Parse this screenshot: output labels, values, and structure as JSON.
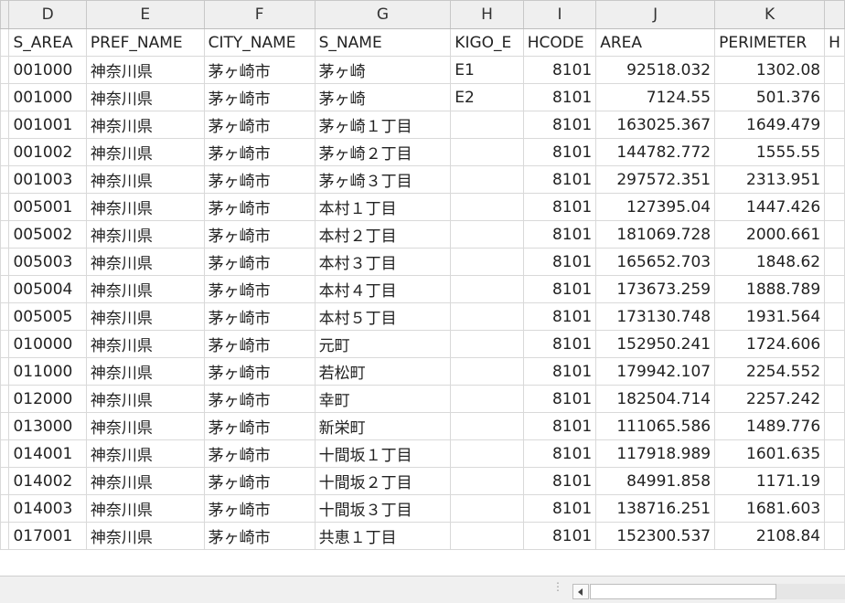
{
  "columns": [
    {
      "letter": "D",
      "header": "S_AREA",
      "align": "left"
    },
    {
      "letter": "E",
      "header": "PREF_NAME",
      "align": "left"
    },
    {
      "letter": "F",
      "header": "CITY_NAME",
      "align": "left"
    },
    {
      "letter": "G",
      "header": "S_NAME",
      "align": "left"
    },
    {
      "letter": "H",
      "header": "KIGO_E",
      "align": "left"
    },
    {
      "letter": "I",
      "header": "HCODE",
      "align": "right"
    },
    {
      "letter": "J",
      "header": "AREA",
      "align": "right"
    },
    {
      "letter": "K",
      "header": "PERIMETER",
      "align": "right"
    },
    {
      "letter": "",
      "header": "H",
      "align": "left"
    }
  ],
  "rows": [
    [
      "001000",
      "神奈川県",
      "茅ヶ崎市",
      "茅ヶ崎",
      "E1",
      "8101",
      "92518.032",
      "1302.08",
      ""
    ],
    [
      "001000",
      "神奈川県",
      "茅ヶ崎市",
      "茅ヶ崎",
      "E2",
      "8101",
      "7124.55",
      "501.376",
      ""
    ],
    [
      "001001",
      "神奈川県",
      "茅ヶ崎市",
      "茅ヶ崎１丁目",
      "",
      "8101",
      "163025.367",
      "1649.479",
      ""
    ],
    [
      "001002",
      "神奈川県",
      "茅ヶ崎市",
      "茅ヶ崎２丁目",
      "",
      "8101",
      "144782.772",
      "1555.55",
      ""
    ],
    [
      "001003",
      "神奈川県",
      "茅ヶ崎市",
      "茅ヶ崎３丁目",
      "",
      "8101",
      "297572.351",
      "2313.951",
      ""
    ],
    [
      "005001",
      "神奈川県",
      "茅ヶ崎市",
      "本村１丁目",
      "",
      "8101",
      "127395.04",
      "1447.426",
      ""
    ],
    [
      "005002",
      "神奈川県",
      "茅ヶ崎市",
      "本村２丁目",
      "",
      "8101",
      "181069.728",
      "2000.661",
      ""
    ],
    [
      "005003",
      "神奈川県",
      "茅ヶ崎市",
      "本村３丁目",
      "",
      "8101",
      "165652.703",
      "1848.62",
      ""
    ],
    [
      "005004",
      "神奈川県",
      "茅ヶ崎市",
      "本村４丁目",
      "",
      "8101",
      "173673.259",
      "1888.789",
      ""
    ],
    [
      "005005",
      "神奈川県",
      "茅ヶ崎市",
      "本村５丁目",
      "",
      "8101",
      "173130.748",
      "1931.564",
      ""
    ],
    [
      "010000",
      "神奈川県",
      "茅ヶ崎市",
      "元町",
      "",
      "8101",
      "152950.241",
      "1724.606",
      ""
    ],
    [
      "011000",
      "神奈川県",
      "茅ヶ崎市",
      "若松町",
      "",
      "8101",
      "179942.107",
      "2254.552",
      ""
    ],
    [
      "012000",
      "神奈川県",
      "茅ヶ崎市",
      "幸町",
      "",
      "8101",
      "182504.714",
      "2257.242",
      ""
    ],
    [
      "013000",
      "神奈川県",
      "茅ヶ崎市",
      "新栄町",
      "",
      "8101",
      "111065.586",
      "1489.776",
      ""
    ],
    [
      "014001",
      "神奈川県",
      "茅ヶ崎市",
      "十間坂１丁目",
      "",
      "8101",
      "117918.989",
      "1601.635",
      ""
    ],
    [
      "014002",
      "神奈川県",
      "茅ヶ崎市",
      "十間坂２丁目",
      "",
      "8101",
      "84991.858",
      "1171.19",
      ""
    ],
    [
      "014003",
      "神奈川県",
      "茅ヶ崎市",
      "十間坂３丁目",
      "",
      "8101",
      "138716.251",
      "1681.603",
      ""
    ],
    [
      "017001",
      "神奈川県",
      "茅ヶ崎市",
      "共恵１丁目",
      "",
      "8101",
      "152300.537",
      "2108.84",
      ""
    ]
  ],
  "status_bar": {
    "split_handle_icon": "vertical-dots-icon",
    "scroll_left_icon": "triangle-left-icon"
  }
}
